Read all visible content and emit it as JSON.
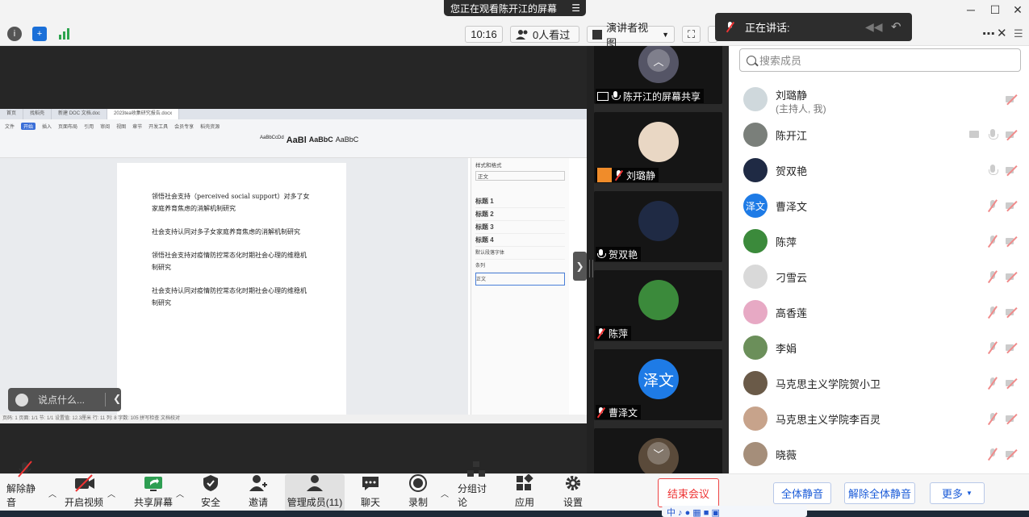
{
  "window": {
    "share_banner": "您正在观看陈开江的屏幕",
    "controls": {
      "minimize": "─",
      "maximize": "☐",
      "close": "✕"
    }
  },
  "topbar": {
    "time": "10:16",
    "viewers": "0人看过",
    "view_mode": "演讲者视图",
    "speaking_label": "正在讲话:"
  },
  "shared_document": {
    "tabs": [
      "首页",
      "找稻壳",
      "新建 DOC 文档.doc",
      "2023tea收集研究报告.docx"
    ],
    "ribbon_tabs": [
      "文件",
      "开始",
      "插入",
      "页面布局",
      "引用",
      "审阅",
      "视图",
      "章节",
      "开发工具",
      "会员专享",
      "稻壳资源"
    ],
    "style_samples": [
      "AaBbCcDd",
      "AaBl",
      "AaBbC",
      "AaBbC"
    ],
    "paragraphs": [
      "领悟社会支持（perceived social support）对多了女家庭养育焦虑的消解机制研究",
      "社会支持认同对多子女家庭养育焦虑的消解机制研究",
      "领悟社会支持对疫情防控常态化时期社会心理的维稳机制研究",
      "社会支持认同对疫情防控常态化时期社会心理的维稳机制研究"
    ],
    "side_panel": {
      "title": "样式和格式",
      "current": "正文",
      "styles": [
        "标题 1",
        "标题 2",
        "标题 3",
        "标题 4",
        "默认段落字体",
        "条列",
        "正文"
      ]
    },
    "status": "页码: 1  页面: 1/1  节: 1/1  设置值: 12.3厘米  行: 11  列: 8  字数: 105  拼写检查  文档校对"
  },
  "chat_box": {
    "placeholder": "说点什么..."
  },
  "thumbnails": [
    {
      "name": "陈开江的屏幕共享",
      "mic": "on",
      "badge": "screen"
    },
    {
      "name": "刘璐静",
      "mic": "off",
      "badge": "host"
    },
    {
      "name": "贺双艳",
      "mic": "on"
    },
    {
      "name": "陈萍",
      "mic": "off"
    },
    {
      "name": "曹泽文",
      "mic": "off",
      "avatar_text": "泽文"
    },
    {
      "name": "",
      "mic": "off"
    }
  ],
  "panel": {
    "search_placeholder": "搜索成员",
    "members": [
      {
        "name": "刘璐静",
        "sub": "(主持人, 我)",
        "mic": "none",
        "cam": "off",
        "screen": false,
        "color": "#cfd8dc"
      },
      {
        "name": "陈开江",
        "mic": "on",
        "cam": "off",
        "screen": true,
        "color": "#7a7f7a"
      },
      {
        "name": "贺双艳",
        "mic": "on",
        "cam": "off",
        "screen": false,
        "color": "#1f2a44"
      },
      {
        "name": "曹泽文",
        "avatar_text": "泽文",
        "mic": "off",
        "cam": "off",
        "screen": false,
        "color": "#1e7be6"
      },
      {
        "name": "陈萍",
        "mic": "off",
        "cam": "off",
        "screen": false,
        "color": "#3b8a3b"
      },
      {
        "name": "刁雪云",
        "mic": "off",
        "cam": "off",
        "screen": false,
        "color": "#d9d9d9"
      },
      {
        "name": "高香莲",
        "mic": "off",
        "cam": "off",
        "screen": false,
        "color": "#e7a9c4"
      },
      {
        "name": "李娟",
        "mic": "off",
        "cam": "off",
        "screen": false,
        "color": "#6b8f5a"
      },
      {
        "name": "马克思主义学院贺小卫",
        "mic": "off",
        "cam": "off",
        "screen": false,
        "color": "#6a5a48"
      },
      {
        "name": "马克思主义学院李百灵",
        "mic": "off",
        "cam": "off",
        "screen": false,
        "color": "#c7a38b"
      },
      {
        "name": "晓薇",
        "mic": "off",
        "cam": "off",
        "screen": false,
        "color": "#a58e7a"
      }
    ]
  },
  "toolbar": {
    "tools": [
      "解除静音",
      "开启视频",
      "共享屏幕",
      "安全",
      "邀请",
      "管理成员(11)",
      "聊天",
      "录制",
      "分组讨论",
      "应用",
      "设置"
    ],
    "end_meeting": "结束会议",
    "mute_all": "全体静音",
    "unmute_all": "解除全体静音",
    "more": "更多"
  },
  "ime": "中 ♪ ● ▦ ■ ▣"
}
